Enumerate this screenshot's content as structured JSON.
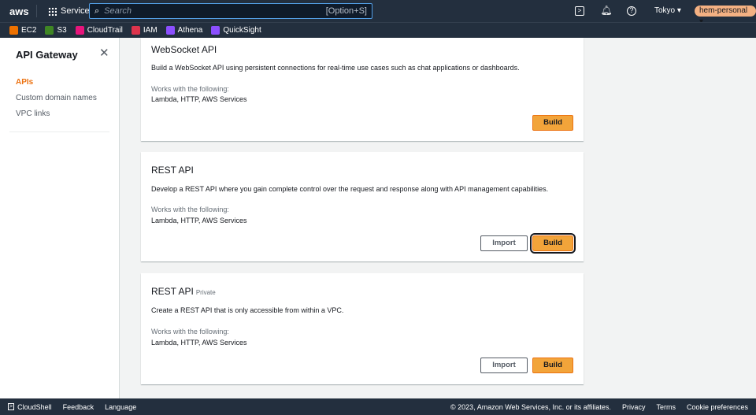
{
  "header": {
    "logo": "aws",
    "services": "Services",
    "search_placeholder": "Search",
    "search_shortcut": "[Option+S]",
    "region": "Tokyo ▾",
    "account": "hem-personal ▾"
  },
  "favorites": [
    {
      "label": "EC2",
      "color": "#ed7100"
    },
    {
      "label": "S3",
      "color": "#3f8624"
    },
    {
      "label": "CloudTrail",
      "color": "#e7157b"
    },
    {
      "label": "IAM",
      "color": "#dd344c"
    },
    {
      "label": "Athena",
      "color": "#8c4fff"
    },
    {
      "label": "QuickSight",
      "color": "#8c4fff"
    }
  ],
  "sidebar": {
    "title": "API Gateway",
    "items": [
      "APIs",
      "Custom domain names",
      "VPC links"
    ]
  },
  "cards": [
    {
      "title": "WebSocket API",
      "desc": "Build a WebSocket API using persistent connections for real-time use cases such as chat applications or dashboards.",
      "works": "Works with the following:",
      "list": "Lambda, HTTP, AWS Services",
      "build": "Build"
    },
    {
      "title": "REST API",
      "desc": "Develop a REST API where you gain complete control over the request and response along with API management capabilities.",
      "works": "Works with the following:",
      "list": "Lambda, HTTP, AWS Services",
      "import": "Import",
      "build": "Build"
    },
    {
      "title": "REST API",
      "badge": "Private",
      "desc": "Create a REST API that is only accessible from within a VPC.",
      "works": "Works with the following:",
      "list": "Lambda, HTTP, AWS Services",
      "import": "Import",
      "build": "Build"
    }
  ],
  "footer": {
    "cloudshell": "CloudShell",
    "feedback": "Feedback",
    "language": "Language",
    "copyright": "© 2023, Amazon Web Services, Inc. or its affiliates.",
    "privacy": "Privacy",
    "terms": "Terms",
    "cookies": "Cookie preferences"
  }
}
